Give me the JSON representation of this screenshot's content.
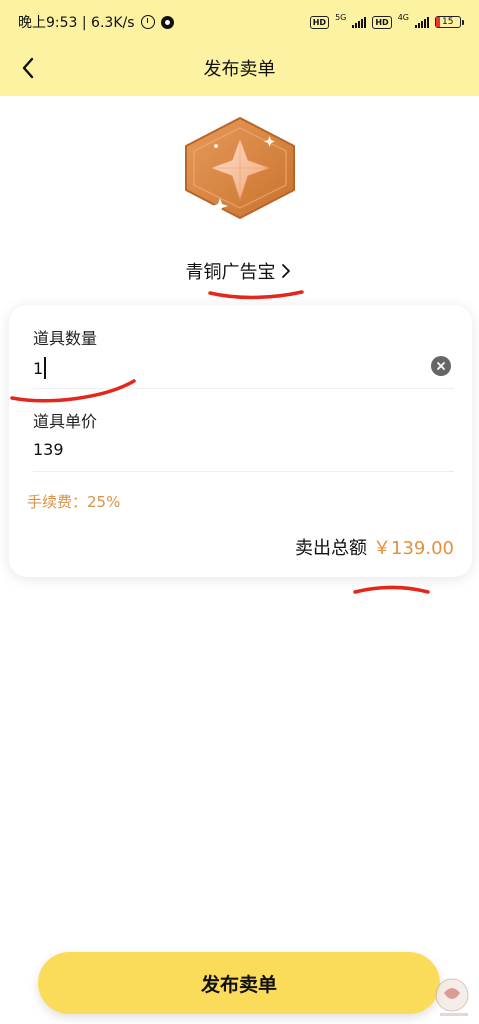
{
  "status_bar": {
    "time_speed": "晚上9:53 | 6.3K/s",
    "sim1_net": "5G",
    "sim2_net": "4G",
    "hd_label": "HD",
    "battery": "15"
  },
  "nav": {
    "title": "发布卖单"
  },
  "item": {
    "name": "青铜广告宝",
    "badge_icon": "bronze-star-hexagon-icon"
  },
  "form": {
    "quantity_label": "道具数量",
    "quantity_value": "1",
    "price_label": "道具单价",
    "price_value": "139",
    "fee_text": "手续费：25%",
    "total_label": "卖出总额",
    "total_amount": "￥139.00"
  },
  "actions": {
    "publish_label": "发布卖单"
  },
  "colors": {
    "header_bg": "#fcf2a2",
    "button_bg": "#fbdc5a",
    "accent_orange": "#e2913f",
    "annotation_red": "#e3271b"
  }
}
